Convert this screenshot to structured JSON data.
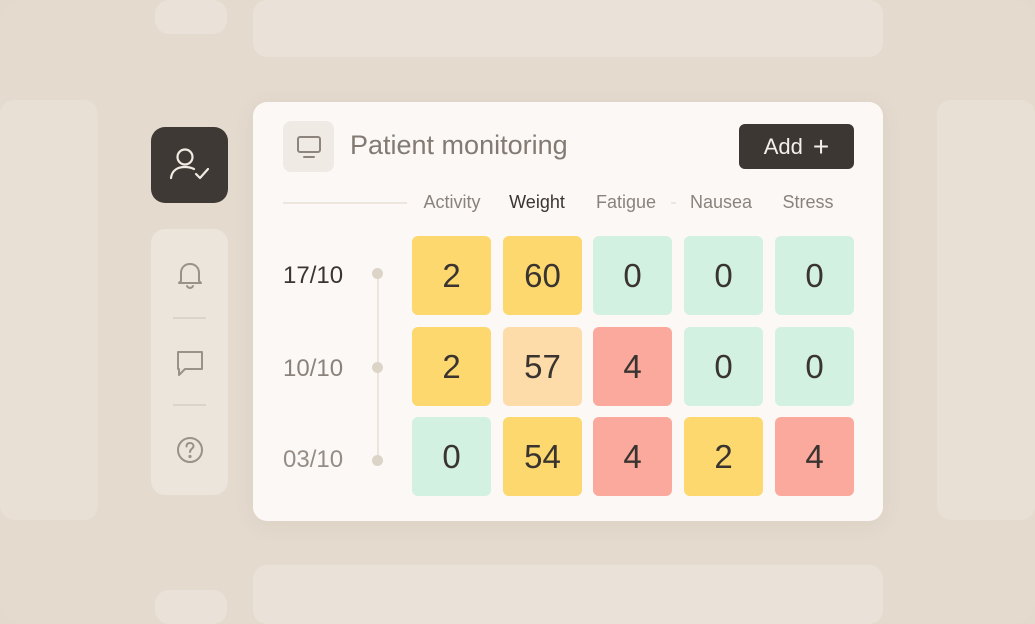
{
  "card": {
    "title": "Patient monitoring",
    "add_label": "Add"
  },
  "columns": [
    "Activity",
    "Weight",
    "Fatigue",
    "Nausea",
    "Stress"
  ],
  "active_column": "Weight",
  "rows": [
    {
      "date": "17/10",
      "values": [
        "2",
        "60",
        "0",
        "0",
        "0"
      ]
    },
    {
      "date": "10/10",
      "values": [
        "2",
        "57",
        "4",
        "0",
        "0"
      ]
    },
    {
      "date": "03/10",
      "values": [
        "0",
        "54",
        "4",
        "2",
        "4"
      ]
    }
  ],
  "cell_levels": [
    [
      "yellow",
      "yellow",
      "green",
      "green",
      "green"
    ],
    [
      "yellow",
      "peach",
      "red",
      "green",
      "green"
    ],
    [
      "green",
      "yellow",
      "red",
      "yellow",
      "red"
    ]
  ],
  "colors": {
    "yellow": "#fdd86e",
    "peach": "#fddcaa",
    "green": "#d3f1e1",
    "red": "#fba99c",
    "dark_tile": "#3f3935"
  },
  "icons": {
    "sidebar_user": "user-check-icon",
    "sidebar_items": [
      "bell-icon",
      "chat-icon",
      "help-icon"
    ],
    "card": "monitor-icon",
    "add": "plus-icon"
  }
}
